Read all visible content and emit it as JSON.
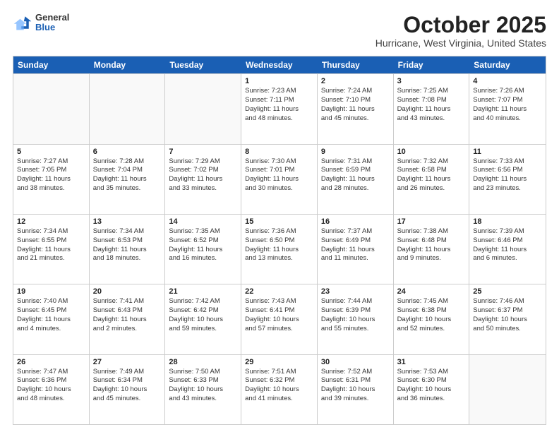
{
  "logo": {
    "general": "General",
    "blue": "Blue"
  },
  "header": {
    "month": "October 2025",
    "location": "Hurricane, West Virginia, United States"
  },
  "days": [
    "Sunday",
    "Monday",
    "Tuesday",
    "Wednesday",
    "Thursday",
    "Friday",
    "Saturday"
  ],
  "rows": [
    [
      {
        "day": "",
        "info": ""
      },
      {
        "day": "",
        "info": ""
      },
      {
        "day": "",
        "info": ""
      },
      {
        "day": "1",
        "info": "Sunrise: 7:23 AM\nSunset: 7:11 PM\nDaylight: 11 hours\nand 48 minutes."
      },
      {
        "day": "2",
        "info": "Sunrise: 7:24 AM\nSunset: 7:10 PM\nDaylight: 11 hours\nand 45 minutes."
      },
      {
        "day": "3",
        "info": "Sunrise: 7:25 AM\nSunset: 7:08 PM\nDaylight: 11 hours\nand 43 minutes."
      },
      {
        "day": "4",
        "info": "Sunrise: 7:26 AM\nSunset: 7:07 PM\nDaylight: 11 hours\nand 40 minutes."
      }
    ],
    [
      {
        "day": "5",
        "info": "Sunrise: 7:27 AM\nSunset: 7:05 PM\nDaylight: 11 hours\nand 38 minutes."
      },
      {
        "day": "6",
        "info": "Sunrise: 7:28 AM\nSunset: 7:04 PM\nDaylight: 11 hours\nand 35 minutes."
      },
      {
        "day": "7",
        "info": "Sunrise: 7:29 AM\nSunset: 7:02 PM\nDaylight: 11 hours\nand 33 minutes."
      },
      {
        "day": "8",
        "info": "Sunrise: 7:30 AM\nSunset: 7:01 PM\nDaylight: 11 hours\nand 30 minutes."
      },
      {
        "day": "9",
        "info": "Sunrise: 7:31 AM\nSunset: 6:59 PM\nDaylight: 11 hours\nand 28 minutes."
      },
      {
        "day": "10",
        "info": "Sunrise: 7:32 AM\nSunset: 6:58 PM\nDaylight: 11 hours\nand 26 minutes."
      },
      {
        "day": "11",
        "info": "Sunrise: 7:33 AM\nSunset: 6:56 PM\nDaylight: 11 hours\nand 23 minutes."
      }
    ],
    [
      {
        "day": "12",
        "info": "Sunrise: 7:34 AM\nSunset: 6:55 PM\nDaylight: 11 hours\nand 21 minutes."
      },
      {
        "day": "13",
        "info": "Sunrise: 7:34 AM\nSunset: 6:53 PM\nDaylight: 11 hours\nand 18 minutes."
      },
      {
        "day": "14",
        "info": "Sunrise: 7:35 AM\nSunset: 6:52 PM\nDaylight: 11 hours\nand 16 minutes."
      },
      {
        "day": "15",
        "info": "Sunrise: 7:36 AM\nSunset: 6:50 PM\nDaylight: 11 hours\nand 13 minutes."
      },
      {
        "day": "16",
        "info": "Sunrise: 7:37 AM\nSunset: 6:49 PM\nDaylight: 11 hours\nand 11 minutes."
      },
      {
        "day": "17",
        "info": "Sunrise: 7:38 AM\nSunset: 6:48 PM\nDaylight: 11 hours\nand 9 minutes."
      },
      {
        "day": "18",
        "info": "Sunrise: 7:39 AM\nSunset: 6:46 PM\nDaylight: 11 hours\nand 6 minutes."
      }
    ],
    [
      {
        "day": "19",
        "info": "Sunrise: 7:40 AM\nSunset: 6:45 PM\nDaylight: 11 hours\nand 4 minutes."
      },
      {
        "day": "20",
        "info": "Sunrise: 7:41 AM\nSunset: 6:43 PM\nDaylight: 11 hours\nand 2 minutes."
      },
      {
        "day": "21",
        "info": "Sunrise: 7:42 AM\nSunset: 6:42 PM\nDaylight: 10 hours\nand 59 minutes."
      },
      {
        "day": "22",
        "info": "Sunrise: 7:43 AM\nSunset: 6:41 PM\nDaylight: 10 hours\nand 57 minutes."
      },
      {
        "day": "23",
        "info": "Sunrise: 7:44 AM\nSunset: 6:39 PM\nDaylight: 10 hours\nand 55 minutes."
      },
      {
        "day": "24",
        "info": "Sunrise: 7:45 AM\nSunset: 6:38 PM\nDaylight: 10 hours\nand 52 minutes."
      },
      {
        "day": "25",
        "info": "Sunrise: 7:46 AM\nSunset: 6:37 PM\nDaylight: 10 hours\nand 50 minutes."
      }
    ],
    [
      {
        "day": "26",
        "info": "Sunrise: 7:47 AM\nSunset: 6:36 PM\nDaylight: 10 hours\nand 48 minutes."
      },
      {
        "day": "27",
        "info": "Sunrise: 7:49 AM\nSunset: 6:34 PM\nDaylight: 10 hours\nand 45 minutes."
      },
      {
        "day": "28",
        "info": "Sunrise: 7:50 AM\nSunset: 6:33 PM\nDaylight: 10 hours\nand 43 minutes."
      },
      {
        "day": "29",
        "info": "Sunrise: 7:51 AM\nSunset: 6:32 PM\nDaylight: 10 hours\nand 41 minutes."
      },
      {
        "day": "30",
        "info": "Sunrise: 7:52 AM\nSunset: 6:31 PM\nDaylight: 10 hours\nand 39 minutes."
      },
      {
        "day": "31",
        "info": "Sunrise: 7:53 AM\nSunset: 6:30 PM\nDaylight: 10 hours\nand 36 minutes."
      },
      {
        "day": "",
        "info": ""
      }
    ]
  ]
}
